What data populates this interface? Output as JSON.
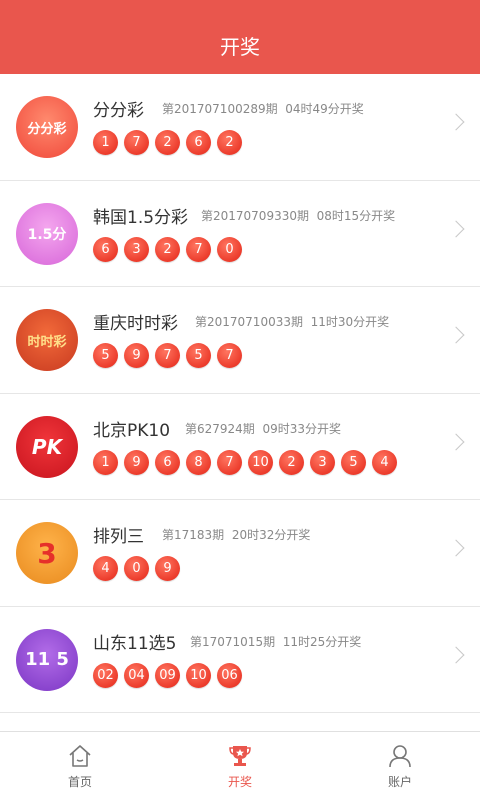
{
  "header": {
    "title": "开奖"
  },
  "colors": {
    "accent": "#e9564d",
    "ball": "#ec3c2c"
  },
  "lotteries": [
    {
      "name": "分分彩",
      "issue": "第201707100289期",
      "time": "04时49分开奖",
      "logo_text": "分分彩",
      "logo_icon": "fenfencai-logo",
      "numbers": [
        "1",
        "7",
        "2",
        "6",
        "2"
      ]
    },
    {
      "name": "韩国1.5分彩",
      "issue": "第20170709330期",
      "time": "08时15分开奖",
      "logo_text": "1.5分",
      "logo_icon": "korea-15-logo",
      "numbers": [
        "6",
        "3",
        "2",
        "7",
        "0"
      ]
    },
    {
      "name": "重庆时时彩",
      "issue": "第20170710033期",
      "time": "11时30分开奖",
      "logo_text": "时时彩",
      "logo_icon": "chongqing-ssc-logo",
      "numbers": [
        "5",
        "9",
        "7",
        "5",
        "7"
      ]
    },
    {
      "name": "北京PK10",
      "issue": "第627924期",
      "time": "09时33分开奖",
      "logo_text": "PK",
      "logo_icon": "beijing-pk10-logo",
      "numbers": [
        "1",
        "9",
        "6",
        "8",
        "7",
        "10",
        "2",
        "3",
        "5",
        "4"
      ]
    },
    {
      "name": "排列三",
      "issue": "第17183期",
      "time": "20时32分开奖",
      "logo_text": "3",
      "logo_icon": "pailie3-logo",
      "numbers": [
        "4",
        "0",
        "9"
      ]
    },
    {
      "name": "山东11选5",
      "issue": "第17071015期",
      "time": "11时25分开奖",
      "logo_text": "11 5",
      "logo_icon": "shandong-11x5-logo",
      "numbers": [
        "02",
        "04",
        "09",
        "10",
        "06"
      ]
    }
  ],
  "tabbar": {
    "home": "首页",
    "draw": "开奖",
    "account": "账户"
  }
}
